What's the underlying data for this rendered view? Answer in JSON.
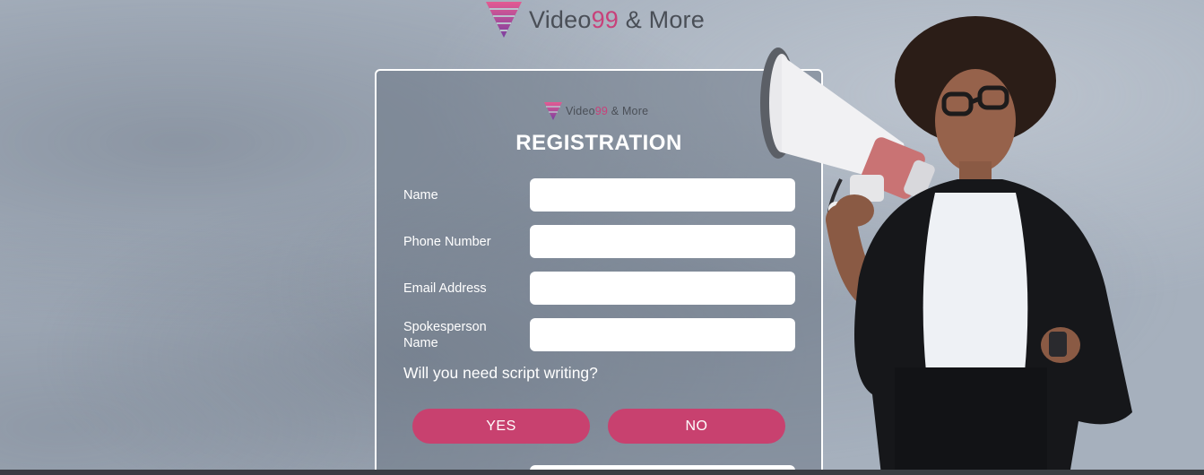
{
  "brand": {
    "name_prefix": "Video",
    "name_number": "99",
    "name_suffix": " & More",
    "accent_color": "#c8417a",
    "logo_icon": "funnel-logo-icon"
  },
  "form": {
    "title": "REGISTRATION",
    "fields": [
      {
        "label": "Name",
        "value": "",
        "placeholder": ""
      },
      {
        "label": "Phone Number",
        "value": "",
        "placeholder": ""
      },
      {
        "label": "Email Address",
        "value": "",
        "placeholder": ""
      },
      {
        "label": "Spokesperson Name",
        "value": "",
        "placeholder": ""
      }
    ],
    "question": "Will you need script writing?",
    "buttons": {
      "yes": "YES",
      "no": "NO"
    },
    "button_color": "#c8416f"
  },
  "hero": {
    "icon": "megaphone-icon"
  }
}
